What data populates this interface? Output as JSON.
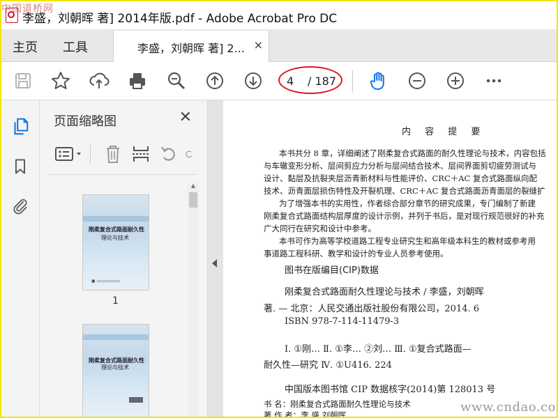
{
  "app": {
    "window_title": "李盛，刘朝晖 著] 2014年版.pdf - Adobe Acrobat Pro DC",
    "watermark_top": "中国道桥网",
    "watermark_bottom": "www.cndao.com"
  },
  "tabs": {
    "home": "主页",
    "tools": "工具",
    "document": "李盛，刘朝晖 著] 2...",
    "close": "×"
  },
  "toolbar": {
    "current_page": "4",
    "total_pages": "/ 187",
    "icons": [
      "save-icon",
      "star-icon",
      "cloud-upload-icon",
      "print-icon",
      "zoom-out-magnifier-icon",
      "page-up-icon",
      "page-down-icon",
      "hand-tool-icon",
      "zoom-out-icon",
      "zoom-in-icon",
      "more-icon"
    ]
  },
  "panel": {
    "title": "页面缩略图",
    "close": "✕",
    "thumbnails": [
      {
        "label": "1",
        "title": "刚柔复合式路面耐久性",
        "subtitle": "理论与技术"
      },
      {
        "label": "",
        "title": "刚柔复合式路面耐久性",
        "subtitle": "理论与技术"
      }
    ]
  },
  "document": {
    "heading": "内 容 提 要",
    "paragraphs": [
      "本书共分 8 章，详细阐述了刚柔复合式路面的耐久性理论与技术，内容包括",
      "与车辙变形分析、层间剪应力分析与层间结合技术、层间界面剪切疲劳测试与",
      "设计、黏层及抗裂夹层沥青新材料与性能评价、CRC＋AC 复合式路面纵向配",
      "技术、沥青面层损伤特性及开裂机理、CRC＋AC 复合式路面沥青面层的裂缝扩",
      "为了增强本书的实用性，作者综合部分章节的研究成果，专门编制了新建",
      "刚柔复合式路面结构层厚度的设计示例，并列于书后，是对现行规范很好的补充",
      "广大同行在研究和设计中参考。",
      "本书可作为高等学校道路工程专业研究生和高年级本科生的教材或参考用",
      "事道路工程科研、教学和设计的专业人员参考使用。"
    ],
    "cip_heading": "图书在版编目(CIP)数据",
    "cip_lines": [
      "刚柔复合式路面耐久性理论与技术 / 李盛，刘朝晖",
      "著. — 北京：人民交通出版社股份有限公司，2014. 6",
      "ISBN  978-7-114-11479-3",
      "Ⅰ. ①刚…   Ⅱ. ①李…  ②刘…   Ⅲ. ①复合式路面—",
      "耐久性—研究   Ⅳ. ①U416. 224",
      "中国版本图书馆 CIP 数据核字(2014)第 128013 号",
      "书      名：刚柔复合式路面耐久性理论与技术",
      "著  作  者：李    盛    刘朝晖"
    ]
  }
}
